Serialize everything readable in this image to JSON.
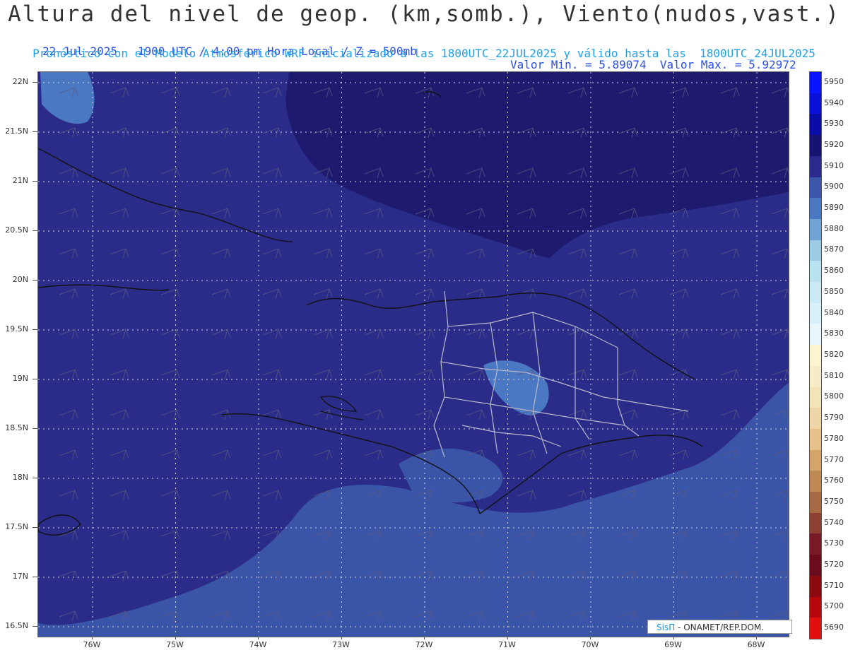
{
  "header": {
    "title": "Altura del nivel de geop. (km,somb.), Viento(nudos,vast.)",
    "date": "22-Jul-2025   1900 UTC / 4:00 pm Hora Local / Z = 500mb",
    "minmax": "Valor Min. = 5.89074  Valor Max. = 5.92972",
    "model_line": "Pronóstico con el Modelo Atmosférico WRF inicializado a las 1800UTC_22JUL2025 y válido hasta las  1800UTC_24JUL2025"
  },
  "map": {
    "lat_labels": [
      "22N",
      "21.5N",
      "21N",
      "20.5N",
      "20N",
      "19.5N",
      "19N",
      "18.5N",
      "18N",
      "17.5N",
      "17N",
      "16.5N"
    ],
    "lon_labels": [
      "76W",
      "75W",
      "74W",
      "73W",
      "72W",
      "71W",
      "70W",
      "69W",
      "68W"
    ],
    "colors": {
      "c5920": "#1e1a6e",
      "c5910": "#2b2c8a",
      "c5900": "#3a55a8",
      "c5890": "#4a78c2",
      "coast": "#111111",
      "border": "#b8b8c8",
      "grid": "#d8d8e0"
    }
  },
  "legend": {
    "levels": [
      "5950",
      "5940",
      "5930",
      "5920",
      "5910",
      "5900",
      "5890",
      "5880",
      "5870",
      "5860",
      "5850",
      "5840",
      "5830",
      "5820",
      "5810",
      "5800",
      "5790",
      "5780",
      "5770",
      "5760",
      "5750",
      "5740",
      "5730",
      "5720",
      "5710",
      "5700",
      "5690"
    ],
    "colors": [
      "#0a14ff",
      "#0a10d8",
      "#0a0ca8",
      "#161470",
      "#2a2a8c",
      "#3b55a8",
      "#4a78c2",
      "#6fa3d6",
      "#9ccbe6",
      "#b8e2f0",
      "#cbeaf5",
      "#d8f0f8",
      "#e6f6fb",
      "#fcf3d0",
      "#f8ecc8",
      "#f4e2b8",
      "#efd6a6",
      "#e6c28a",
      "#d3a56a",
      "#bf8a55",
      "#a86a45",
      "#8e3f34",
      "#781b26",
      "#6a0c1c",
      "#8a0a10",
      "#b8080c",
      "#e0100f"
    ]
  },
  "credit": {
    "brand": "SisΠ",
    "text": " - ONAMET/REP.DOM."
  }
}
